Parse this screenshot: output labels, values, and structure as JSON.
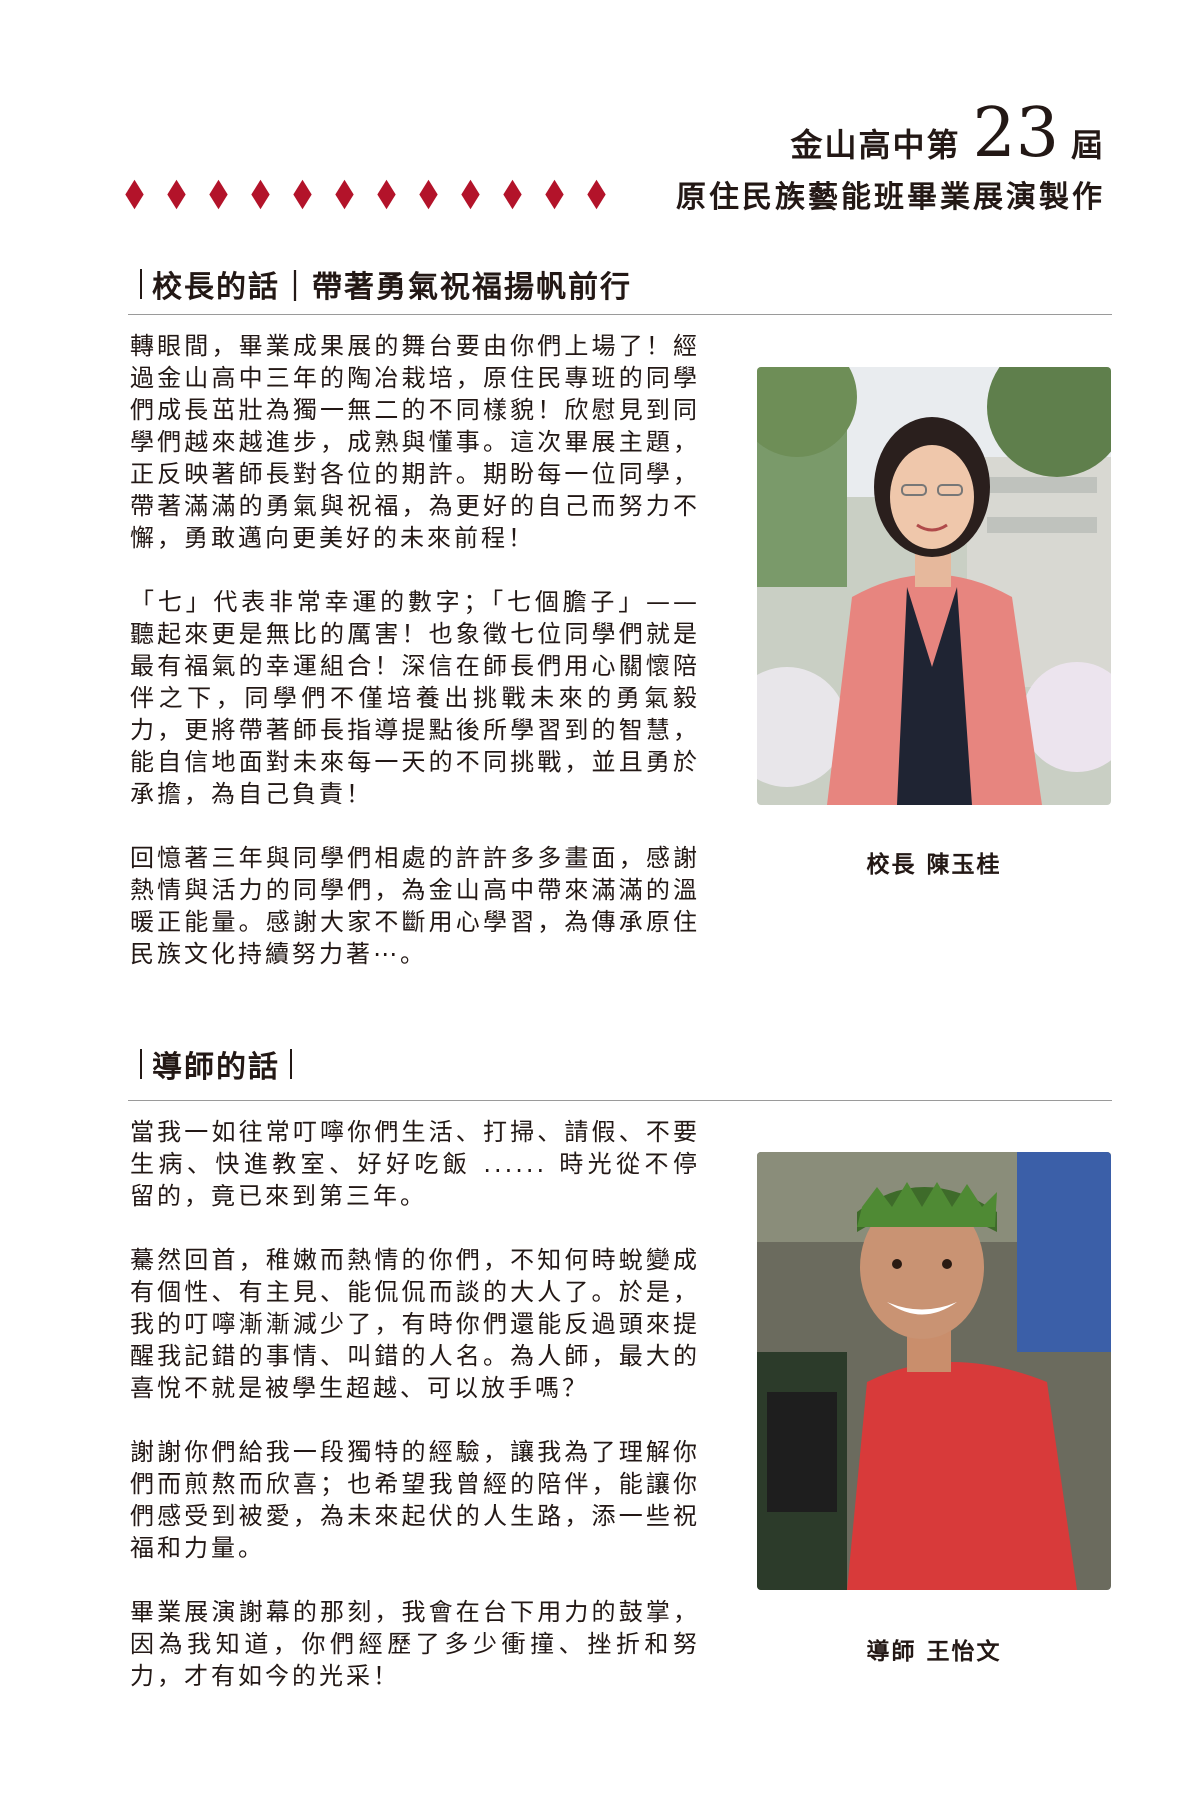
{
  "header": {
    "school_prefix": "金山高中第",
    "edition_number": "23",
    "edition_suffix": "屆",
    "subtitle": "原住民族藝能班畢業展演製作"
  },
  "principal_section": {
    "heading": "校長的話｜帶著勇氣祝福揚帆前行",
    "paragraphs": [
      "轉眼間，畢業成果展的舞台要由你們上場了！經過金山高中三年的陶冶栽培，原住民專班的同學們成長茁壯為獨一無二的不同樣貌！欣慰見到同學們越來越進步，成熟與懂事。這次畢展主題，正反映著師長對各位的期許。期盼每一位同學，帶著滿滿的勇氣與祝福，為更好的自己而努力不懈，勇敢邁向更美好的未來前程！",
      "「七」代表非常幸運的數字；「七個膽子」—— 聽起來更是無比的厲害！也象徵七位同學們就是最有福氣的幸運組合！深信在師長們用心關懷陪伴之下，同學們不僅培養出挑戰未來的勇氣毅力，更將帶著師長指導提點後所學習到的智慧，能自信地面對未來每一天的不同挑戰，並且勇於承擔，為自己負責！",
      "回憶著三年與同學們相處的許許多多畫面，感謝熱情與活力的同學們，為金山高中帶來滿滿的溫暖正能量。感謝大家不斷用心學習，為傳承原住民族文化持續努力著⋯。"
    ],
    "caption": "校長  陳玉桂"
  },
  "teacher_section": {
    "heading": "導師的話",
    "paragraphs": [
      "當我一如往常叮嚀你們生活、打掃、請假、不要生病、快進教室、好好吃飯 ...... 時光從不停留的，竟已來到第三年。",
      "驀然回首，稚嫩而熱情的你們，不知何時蛻變成有個性、有主見、能侃侃而談的大人了。於是，我的叮嚀漸漸減少了，有時你們還能反過頭來提醒我記錯的事情、叫錯的人名。為人師，最大的喜悅不就是被學生超越、可以放手嗎？",
      "謝謝你們給我一段獨特的經驗，讓我為了理解你們而煎熬而欣喜；也希望我曾經的陪伴，能讓你們感受到被愛，為未來起伏的人生路，添一些祝福和力量。",
      "畢業展演謝幕的那刻，我會在台下用力的鼓掌，因為我知道，你們經歷了多少衝撞、挫折和努力，才有如今的光采！"
    ],
    "caption": "導師  王怡文"
  },
  "colors": {
    "accent_red": "#b3132a",
    "text": "#231815",
    "rule": "#9a9a9a"
  }
}
